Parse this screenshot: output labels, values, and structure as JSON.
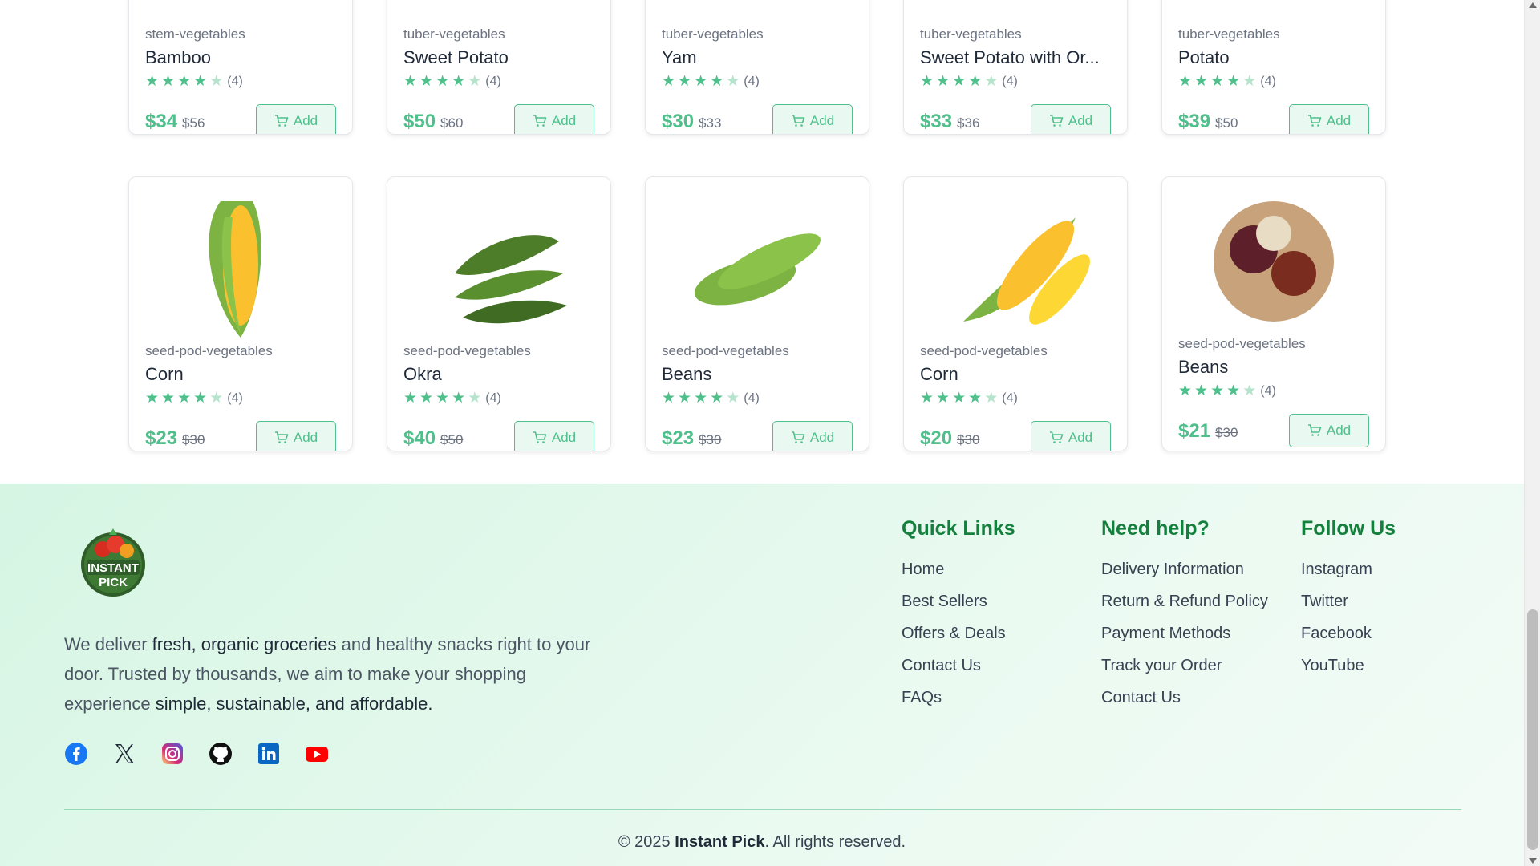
{
  "products_row1": [
    {
      "category": "stem-vegetables",
      "name": "Bamboo",
      "rating_count": "(4)",
      "price": "$34",
      "old_price": "$56",
      "add_label": "Add"
    },
    {
      "category": "tuber-vegetables",
      "name": "Sweet Potato",
      "rating_count": "(4)",
      "price": "$50",
      "old_price": "$60",
      "add_label": "Add"
    },
    {
      "category": "tuber-vegetables",
      "name": "Yam",
      "rating_count": "(4)",
      "price": "$30",
      "old_price": "$33",
      "add_label": "Add"
    },
    {
      "category": "tuber-vegetables",
      "name": "Sweet Potato with Or...",
      "rating_count": "(4)",
      "price": "$33",
      "old_price": "$36",
      "add_label": "Add"
    },
    {
      "category": "tuber-vegetables",
      "name": "Potato",
      "rating_count": "(4)",
      "price": "$39",
      "old_price": "$50",
      "add_label": "Add"
    }
  ],
  "products_row2": [
    {
      "category": "seed-pod-vegetables",
      "name": "Corn",
      "rating_count": "(4)",
      "price": "$23",
      "old_price": "$30",
      "add_label": "Add"
    },
    {
      "category": "seed-pod-vegetables",
      "name": "Okra",
      "rating_count": "(4)",
      "price": "$40",
      "old_price": "$50",
      "add_label": "Add"
    },
    {
      "category": "seed-pod-vegetables",
      "name": "Beans",
      "rating_count": "(4)",
      "price": "$23",
      "old_price": "$30",
      "add_label": "Add"
    },
    {
      "category": "seed-pod-vegetables",
      "name": "Corn",
      "rating_count": "(4)",
      "price": "$20",
      "old_price": "$30",
      "add_label": "Add"
    },
    {
      "category": "seed-pod-vegetables",
      "name": "Beans",
      "rating_count": "(4)",
      "price": "$21",
      "old_price": "$30",
      "add_label": "Add"
    }
  ],
  "rating_stars": 4,
  "footer": {
    "logo_text_1": "INSTANT",
    "logo_text_2": "PICK",
    "about_1": "We deliver ",
    "about_bold_1": "fresh, organic groceries",
    "about_2": " and healthy snacks right to your door. Trusted by thousands, we aim to make your shopping experience ",
    "about_bold_2": "simple, sustainable, and affordable.",
    "quick_links_title": "Quick Links",
    "quick_links": [
      "Home",
      "Best Sellers",
      "Offers & Deals",
      "Contact Us",
      "FAQs"
    ],
    "help_title": "Need help?",
    "help_links": [
      "Delivery Information",
      "Return & Refund Policy",
      "Payment Methods",
      "Track your Order",
      "Contact Us"
    ],
    "follow_title": "Follow Us",
    "follow_links": [
      "Instagram",
      "Twitter",
      "Facebook",
      "YouTube"
    ],
    "copyright_prefix": "© 2025 ",
    "copyright_brand": "Instant Pick",
    "copyright_suffix": ". All rights reserved."
  },
  "colors": {
    "accent": "#4fbf8b",
    "heading_green": "#15803d"
  }
}
